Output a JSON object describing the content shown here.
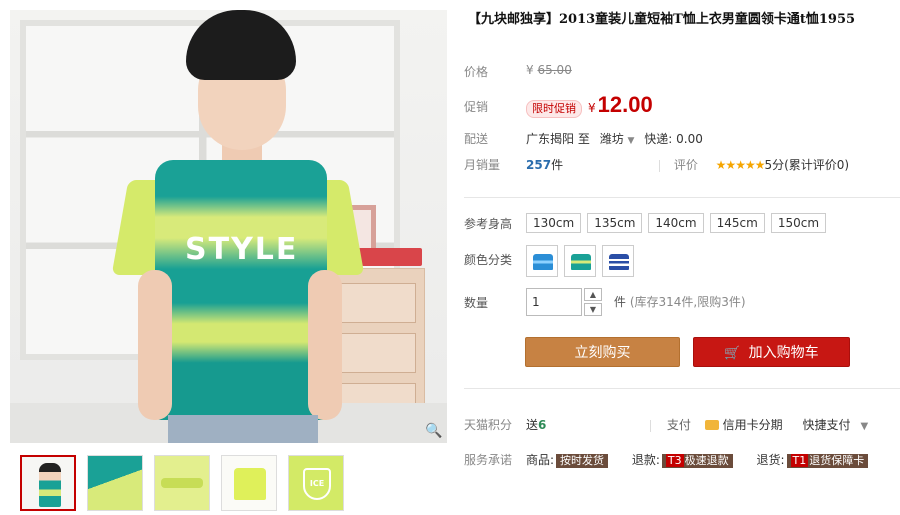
{
  "product": {
    "title": "【九块邮独享】2013童装儿童短袖T恤上衣男童圆领卡通t恤1955",
    "main_image_text": "STYLE",
    "thumbnail_badge_text": "ICE"
  },
  "price": {
    "label": "价格",
    "currency": "¥",
    "original": "65.00"
  },
  "promo": {
    "label": "促销",
    "tag": "限时促销",
    "currency": "¥",
    "price": "12.00"
  },
  "shipping": {
    "label": "配送",
    "from": "广东揭阳",
    "to_word": "至",
    "destination": "潍坊",
    "fee_text": "快递: 0.00"
  },
  "sales": {
    "label": "月销量",
    "count": "257",
    "unit": "件",
    "rating_label": "评价",
    "stars": "★★★★★",
    "rating_text": "5分(累计评价0)"
  },
  "sizes": {
    "label": "参考身高",
    "options": [
      "130cm",
      "135cm",
      "140cm",
      "145cm",
      "150cm"
    ]
  },
  "colors": {
    "label": "颜色分类",
    "options": [
      "blue-stripe",
      "green-stripe",
      "navy-stripe"
    ]
  },
  "quantity": {
    "label": "数量",
    "value": "1",
    "up": "▲",
    "down": "▼",
    "unit": "件",
    "stock_text": "(库存314件,限购3件)"
  },
  "actions": {
    "buy_now": "立刻购买",
    "cart_icon": "🛒",
    "add_to_cart": "加入购物车"
  },
  "points": {
    "label": "天猫积分",
    "give": "送",
    "amount": "6",
    "pay_label": "支付",
    "credit_text": "信用卡分期",
    "quick_pay": "快捷支付"
  },
  "service": {
    "label": "服务承诺",
    "goods_label": "商品:",
    "goods_tag": "按时发货",
    "refund_label": "退款:",
    "refund_t": "T3",
    "refund_tag": "极速退款",
    "return_label": "退货:",
    "return_t": "T1",
    "return_tag": "退货保障卡"
  },
  "colors_theme": {
    "accent_red": "#c40000",
    "buy_brown": "#c78243",
    "cart_red": "#c71713"
  }
}
